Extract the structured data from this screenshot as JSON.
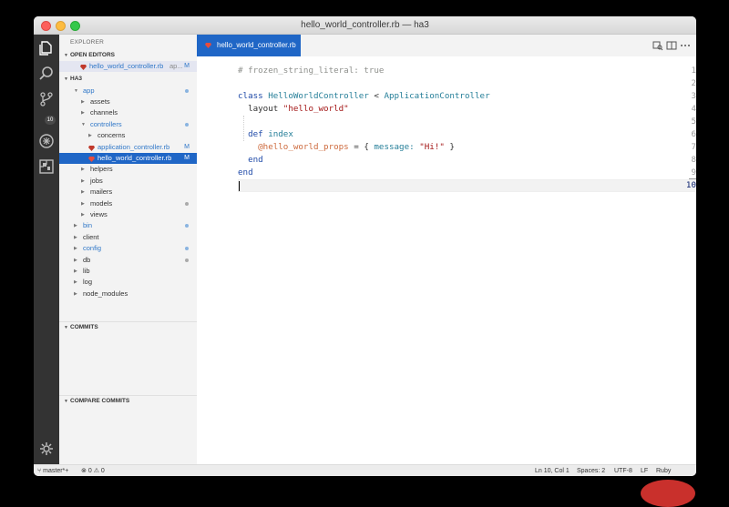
{
  "window": {
    "title": "hello_world_controller.rb — ha3"
  },
  "activity_bar": {
    "icons": [
      "explorer-icon",
      "search-icon",
      "source-control-icon",
      "debug-icon",
      "extensions-icon",
      "settings-gear-icon"
    ],
    "scm_badge": "10"
  },
  "sidebar": {
    "title": "EXPLORER",
    "open_editors": {
      "header": "OPEN EDITORS",
      "file": "hello_world_controller.rb",
      "file_extra": "ap...",
      "status": "M"
    },
    "workspace": {
      "header": "HA3",
      "items": [
        {
          "label": "app",
          "indent": 1,
          "kind": "folder-open",
          "color": "blue",
          "dot": "#8ab4e0"
        },
        {
          "label": "assets",
          "indent": 2,
          "kind": "folder"
        },
        {
          "label": "channels",
          "indent": 2,
          "kind": "folder"
        },
        {
          "label": "controllers",
          "indent": 2,
          "kind": "folder-open",
          "color": "blue",
          "dot": "#8ab4e0"
        },
        {
          "label": "concerns",
          "indent": 3,
          "kind": "folder"
        },
        {
          "label": "application_controller.rb",
          "indent": 3,
          "kind": "ruby-file",
          "color": "blue",
          "status": "M"
        },
        {
          "label": "hello_world_controller.rb",
          "indent": 3,
          "kind": "ruby-file",
          "selected": true,
          "status": "M"
        },
        {
          "label": "helpers",
          "indent": 2,
          "kind": "folder"
        },
        {
          "label": "jobs",
          "indent": 2,
          "kind": "folder"
        },
        {
          "label": "mailers",
          "indent": 2,
          "kind": "folder"
        },
        {
          "label": "models",
          "indent": 2,
          "kind": "folder",
          "dot": "#aaaaaa"
        },
        {
          "label": "views",
          "indent": 2,
          "kind": "folder"
        },
        {
          "label": "bin",
          "indent": 1,
          "kind": "folder",
          "color": "blue",
          "dot": "#8ab4e0"
        },
        {
          "label": "client",
          "indent": 1,
          "kind": "folder"
        },
        {
          "label": "config",
          "indent": 1,
          "kind": "folder",
          "color": "blue",
          "dot": "#8ab4e0"
        },
        {
          "label": "db",
          "indent": 1,
          "kind": "folder",
          "dot": "#aaaaaa"
        },
        {
          "label": "lib",
          "indent": 1,
          "kind": "folder"
        },
        {
          "label": "log",
          "indent": 1,
          "kind": "folder"
        },
        {
          "label": "node_modules",
          "indent": 1,
          "kind": "folder"
        }
      ]
    },
    "commits_header": "COMMITS",
    "compare_commits_header": "COMPARE COMMITS"
  },
  "editor": {
    "tab_label": "hello_world_controller.rb",
    "actions": [
      "open-preview-icon",
      "split-editor-icon",
      "more-actions-icon"
    ],
    "lines": [
      [
        {
          "t": "# frozen_string_literal: true",
          "c": "comment"
        }
      ],
      [],
      [
        {
          "t": "class ",
          "c": "kw"
        },
        {
          "t": "HelloWorldController",
          "c": "cls"
        },
        {
          "t": " < ",
          "c": "plain"
        },
        {
          "t": "ApplicationController",
          "c": "cls"
        }
      ],
      [
        {
          "t": "  layout ",
          "c": "plain"
        },
        {
          "t": "\"hello_world\"",
          "c": "str"
        }
      ],
      [],
      [
        {
          "t": "  def ",
          "c": "kw"
        },
        {
          "t": "index",
          "c": "cls"
        }
      ],
      [
        {
          "t": "    ",
          "c": "plain"
        },
        {
          "t": "@hello_world_props",
          "c": "ivar"
        },
        {
          "t": " = { ",
          "c": "plain"
        },
        {
          "t": "message:",
          "c": "sym"
        },
        {
          "t": " ",
          "c": "plain"
        },
        {
          "t": "\"Hi!\"",
          "c": "str"
        },
        {
          "t": " }",
          "c": "plain"
        }
      ],
      [
        {
          "t": "  end",
          "c": "kw"
        }
      ],
      [
        {
          "t": "end",
          "c": "kw"
        }
      ],
      []
    ],
    "line_numbers": [
      "1",
      "2",
      "3",
      "4",
      "5",
      "6",
      "7",
      "8",
      "9",
      "10"
    ],
    "active_line": 10
  },
  "status_bar": {
    "branch": "master*+",
    "errors": "0",
    "warnings": "0",
    "position": "Ln 10, Col 1",
    "spaces": "Spaces: 2",
    "encoding": "UTF-8",
    "eol": "LF",
    "language": "Ruby"
  }
}
